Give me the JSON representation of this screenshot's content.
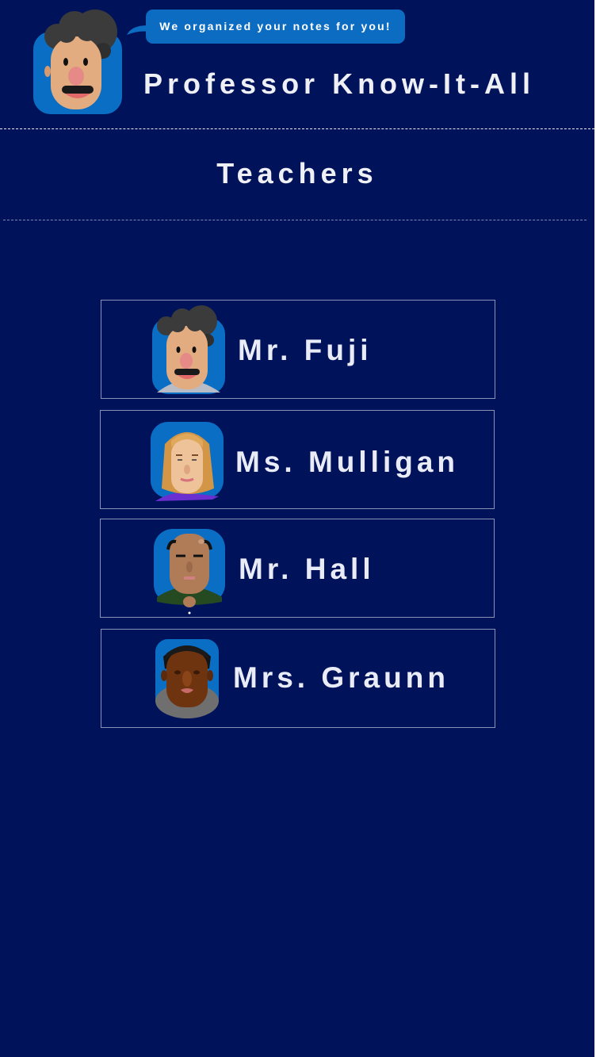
{
  "header": {
    "speech_bubble": "We organized your notes for you!",
    "title": "Professor Know-It-All",
    "avatar_icon": "professor-avatar-icon"
  },
  "page": {
    "heading": "Teachers"
  },
  "teachers": [
    {
      "name": "Mr. Fuji",
      "avatar": "curly-hair-man-avatar-icon"
    },
    {
      "name": "Ms. Mulligan",
      "avatar": "blonde-woman-avatar-icon"
    },
    {
      "name": "Mr. Hall",
      "avatar": "bald-man-avatar-icon"
    },
    {
      "name": "Mrs. Graunn",
      "avatar": "dark-skinned-man-avatar-icon"
    }
  ],
  "colors": {
    "background": "#00135a",
    "bubble": "#0c6cc2",
    "avatar_bg": "#0a6fc4",
    "text": "#eef0f6"
  }
}
